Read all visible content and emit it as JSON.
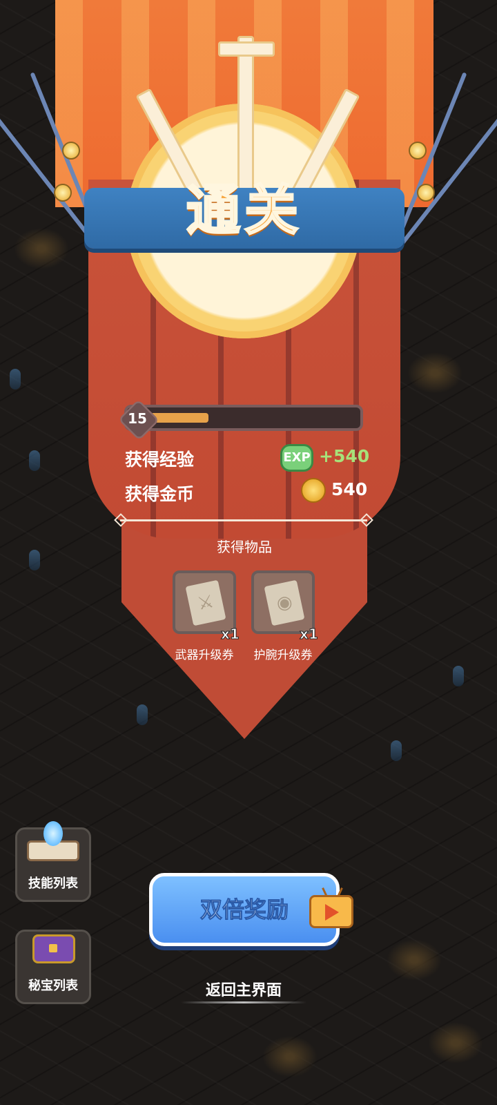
{
  "banner": {
    "title": "通关"
  },
  "level": {
    "number": "15",
    "progress": 0.28
  },
  "rewards": {
    "exp_label": "获得经验",
    "exp_icon_text": "EXP",
    "exp_value": "+540",
    "gold_label": "获得金币",
    "gold_value": "540"
  },
  "items": {
    "section_title": "获得物品",
    "list": [
      {
        "name": "武器升级券",
        "qty": "x1",
        "icon": "weapon-ticket-icon"
      },
      {
        "name": "护腕升级券",
        "qty": "x1",
        "icon": "bracer-ticket-icon"
      }
    ]
  },
  "side_buttons": [
    {
      "label": "技能列表",
      "icon": "skill-book-icon"
    },
    {
      "label": "秘宝列表",
      "icon": "treasure-chest-icon"
    }
  ],
  "actions": {
    "double_reward": "双倍奖励",
    "back_home": "返回主界面"
  },
  "colors": {
    "accent_gold": "#e7a24a",
    "exp_green": "#a7e27a",
    "button_blue": "#4a8ff0"
  }
}
